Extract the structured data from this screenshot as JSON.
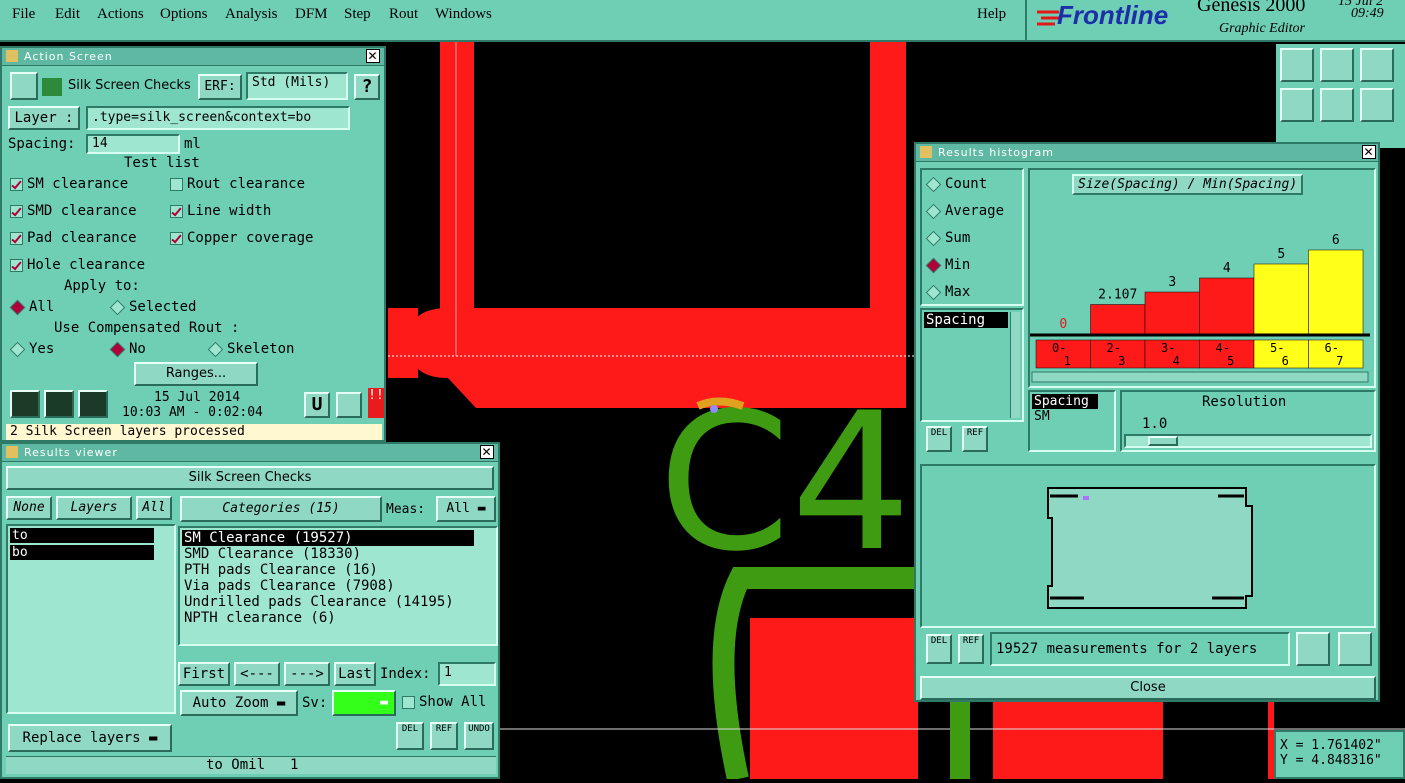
{
  "menu": {
    "items": [
      "File",
      "Edit",
      "Actions",
      "Options",
      "Analysis",
      "DFM",
      "Step",
      "Rout",
      "Windows"
    ],
    "help": "Help",
    "brand": "Frontline",
    "product": "Genesis 2000",
    "subtitle": "Graphic Editor",
    "date_partial": "15 Jul 2",
    "time": "09:49"
  },
  "action_screen": {
    "title": "Action Screen",
    "header": "Silk Screen Checks",
    "erf_label": "ERF:",
    "erf_value": "Std (Mils)",
    "help_btn": "?",
    "layer_label": "Layer :",
    "layer_value": ".type=silk_screen&context=bo",
    "spacing_label": "Spacing:",
    "spacing_value": "14",
    "spacing_unit": "ml",
    "test_list_label": "Test list",
    "tests": [
      {
        "label": "SM clearance",
        "checked": true
      },
      {
        "label": "Rout clearance",
        "checked": false
      },
      {
        "label": "SMD clearance",
        "checked": true
      },
      {
        "label": "Line width",
        "checked": true
      },
      {
        "label": "Pad clearance",
        "checked": true
      },
      {
        "label": "Copper coverage",
        "checked": true
      },
      {
        "label": "Hole clearance",
        "checked": true
      }
    ],
    "apply_to_label": "Apply to:",
    "apply_all": "All",
    "apply_selected": "Selected",
    "comp_rout_label": "Use Compensated Rout :",
    "comp_yes": "Yes",
    "comp_no": "No",
    "comp_skeleton": "Skeleton",
    "ranges_btn": "Ranges...",
    "date": "15 Jul 2014",
    "time": "10:03 AM - 0:02:04",
    "status": "2 Silk Screen layers processed"
  },
  "results_viewer": {
    "title": "Results viewer",
    "header": "Silk Screen Checks",
    "none_btn": "None",
    "layers_btn": "Layers",
    "all_btn": "All",
    "layers": [
      "to",
      "bo"
    ],
    "categories_label": "Categories (15)",
    "meas_label": "Meas:",
    "meas_value": "All",
    "categories": [
      "SM Clearance (19527)",
      "SMD Clearance (18330)",
      "PTH pads Clearance (16)",
      "Via pads Clearance (7908)",
      "Undrilled pads Clearance (14195)",
      "NPTH clearance (6)"
    ],
    "first_btn": "First",
    "prev_btn": "<---",
    "next_btn": "--->",
    "last_btn": "Last",
    "index_label": "Index:",
    "index_value": "1",
    "auto_zoom": "Auto Zoom",
    "sv_label": "Sv:",
    "show_all": "Show All",
    "replace_layers": "Replace layers",
    "del": "DEL",
    "ref": "REF",
    "undo": "UNDO",
    "footer_left": "to Omil",
    "footer_right": "1"
  },
  "histogram": {
    "title": "Results histogram",
    "modes": [
      "Count",
      "Average",
      "Sum",
      "Min",
      "Max"
    ],
    "selected_mode": "Min",
    "chart_title": "Size(Spacing) / Min(Spacing)",
    "list_items": [
      "Spacing"
    ],
    "sub_list": [
      "Spacing",
      "SM"
    ],
    "resolution_label": "Resolution",
    "resolution_value": "1.0",
    "measurements": "19527 measurements for 2 layers",
    "close_btn": "Close",
    "del": "DEL",
    "ref": "REF",
    "colors": {
      "red": "#ff1a1a",
      "yellow": "#ffff1a"
    }
  },
  "chart_data": {
    "type": "bar",
    "categories": [
      "0-1",
      "2-3",
      "3-4",
      "4-5",
      "5-6",
      "6-7"
    ],
    "values": [
      0,
      2.107,
      3,
      4,
      5,
      6
    ],
    "value_labels": [
      "0",
      "2.107",
      "3",
      "4",
      "5",
      "6"
    ],
    "bar_colors": [
      "red",
      "red",
      "red",
      "red",
      "yellow",
      "yellow"
    ],
    "ylim": [
      0,
      6
    ]
  },
  "board": {
    "silk_text": "C4",
    "coords_x": "X = 1.761402\"",
    "coords_y": "Y = 4.848316\""
  }
}
